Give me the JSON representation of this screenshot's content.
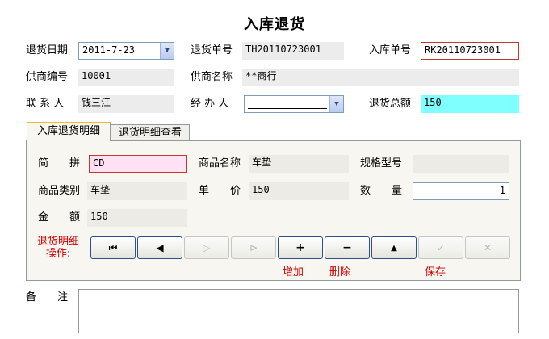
{
  "window_title": "入库退货",
  "header": {
    "return_date_label": "退货日期",
    "return_date_value": "2011-7-23",
    "return_no_label": "退货单号",
    "return_no_value": "TH20110723001",
    "storage_no_label": "入库单号",
    "storage_no_value": "RK20110723001",
    "supplier_code_label": "供商编号",
    "supplier_code_value": "10001",
    "supplier_name_label": "供商名称",
    "supplier_name_value": "**商行",
    "contact_label": "联 系 人",
    "contact_value": "钱三江",
    "handler_label": "经 办 人",
    "handler_value": "",
    "total_label": "退货总额",
    "total_value": "150"
  },
  "tabs": [
    {
      "label": "入库退货明细",
      "active": true
    },
    {
      "label": "退货明细查看",
      "active": false
    }
  ],
  "detail": {
    "pinyin_label": "简　　拼",
    "pinyin_value": "CD",
    "product_name_label": "商品名称",
    "product_name_value": "车垫",
    "spec_label": "规格型号",
    "spec_value": "",
    "category_label": "商品类别",
    "category_value": "车垫",
    "unit_price_label": "单　　价",
    "unit_price_value": "150",
    "quantity_label": "数　　量",
    "quantity_value": "1",
    "amount_label": "金　　额",
    "amount_value": "150"
  },
  "operations": {
    "label_line1": "退货明细",
    "label_line2": "操作:",
    "buttons": [
      {
        "name": "first",
        "icon": "first-record-icon",
        "glyph": "⏮",
        "enabled": true
      },
      {
        "name": "prev",
        "icon": "prev-record-icon",
        "glyph": "◀",
        "enabled": true
      },
      {
        "name": "next",
        "icon": "next-record-icon",
        "glyph": "▷",
        "enabled": false
      },
      {
        "name": "last",
        "icon": "last-record-icon",
        "glyph": "⊳",
        "enabled": false
      },
      {
        "name": "add",
        "icon": "plus-icon",
        "glyph": "+",
        "enabled": true
      },
      {
        "name": "delete",
        "icon": "minus-icon",
        "glyph": "−",
        "enabled": true
      },
      {
        "name": "edit",
        "icon": "up-triangle-icon",
        "glyph": "▲",
        "enabled": true
      },
      {
        "name": "save",
        "icon": "check-icon",
        "glyph": "✓",
        "enabled": false
      },
      {
        "name": "cancel",
        "icon": "x-icon",
        "glyph": "✕",
        "enabled": false
      }
    ],
    "add_caption": "增加",
    "delete_caption": "删除",
    "save_caption": "保存"
  },
  "notes_label": "备　　注",
  "notes_value": "",
  "colors": {
    "total_bg": "#80ffff",
    "pinyin_bg": "#ffe0f5",
    "red_text": "#d00000",
    "required_border": "#c0392b"
  }
}
